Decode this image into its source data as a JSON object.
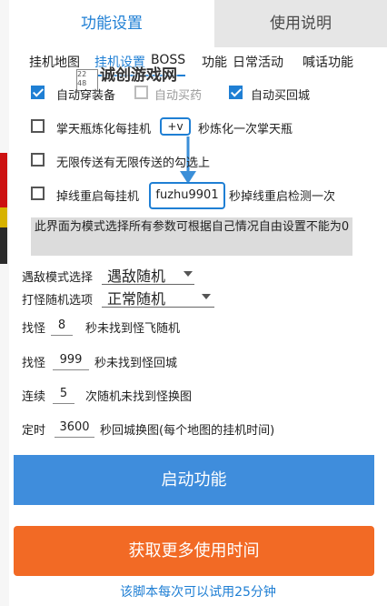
{
  "tabs": [
    "功能设置",
    "使用说明"
  ],
  "subnav": {
    "items": [
      "挂机地图",
      "挂机设置",
      "BOSS",
      "功能",
      "日常活动",
      "喊话功能"
    ],
    "active_index": 1
  },
  "watermark": "诚创游戏网",
  "watermark_logo": "22\n48",
  "checks": {
    "auto_wear": {
      "label": "自动穿装备",
      "checked": true
    },
    "auto_buy_medicine": {
      "label": "自动买药",
      "checked": false
    },
    "auto_buy_return": {
      "label": "自动买回城",
      "checked": true
    }
  },
  "palm_bottle": {
    "label_before": "掌天瓶炼化每挂机",
    "value": "+v",
    "label_after": "秒炼化一次掌天瓶",
    "checked": false
  },
  "infinite_teleport": {
    "label": "无限传送有无限传送的勾选上",
    "checked": false
  },
  "reconnect": {
    "label_before": "掉线重启每挂机",
    "value": "fuzhu9901",
    "label_after": "秒掉线重启检测一次",
    "checked": false
  },
  "notice": "此界面为模式选择所有参数可根据自己情况自由设置不能为0",
  "selects": {
    "enemy_mode": {
      "label": "遇敌模式选择",
      "value": "遇敌随机"
    },
    "monster_random": {
      "label": "打怪随机选项",
      "value": "正常随机"
    }
  },
  "settings": [
    {
      "label_before": "找怪",
      "value": "8",
      "label_after": "秒未找到怪飞随机"
    },
    {
      "label_before": "找怪",
      "value": "999",
      "label_after": "秒未找到怪回城"
    },
    {
      "label_before": "连续",
      "value": "5",
      "label_after": "次随机未找到怪换图"
    },
    {
      "label_before": "定时",
      "value": "3600",
      "label_after": "秒回城换图(每个地图的挂机时间)"
    }
  ],
  "start_button": "启动功能",
  "more_time_button": "获取更多使用时间",
  "footer": "该脚本每次可以试用25分钟",
  "colors": {
    "accent": "#1f7fd4",
    "start": "#3f8ddc",
    "more_time": "#f26a25"
  }
}
